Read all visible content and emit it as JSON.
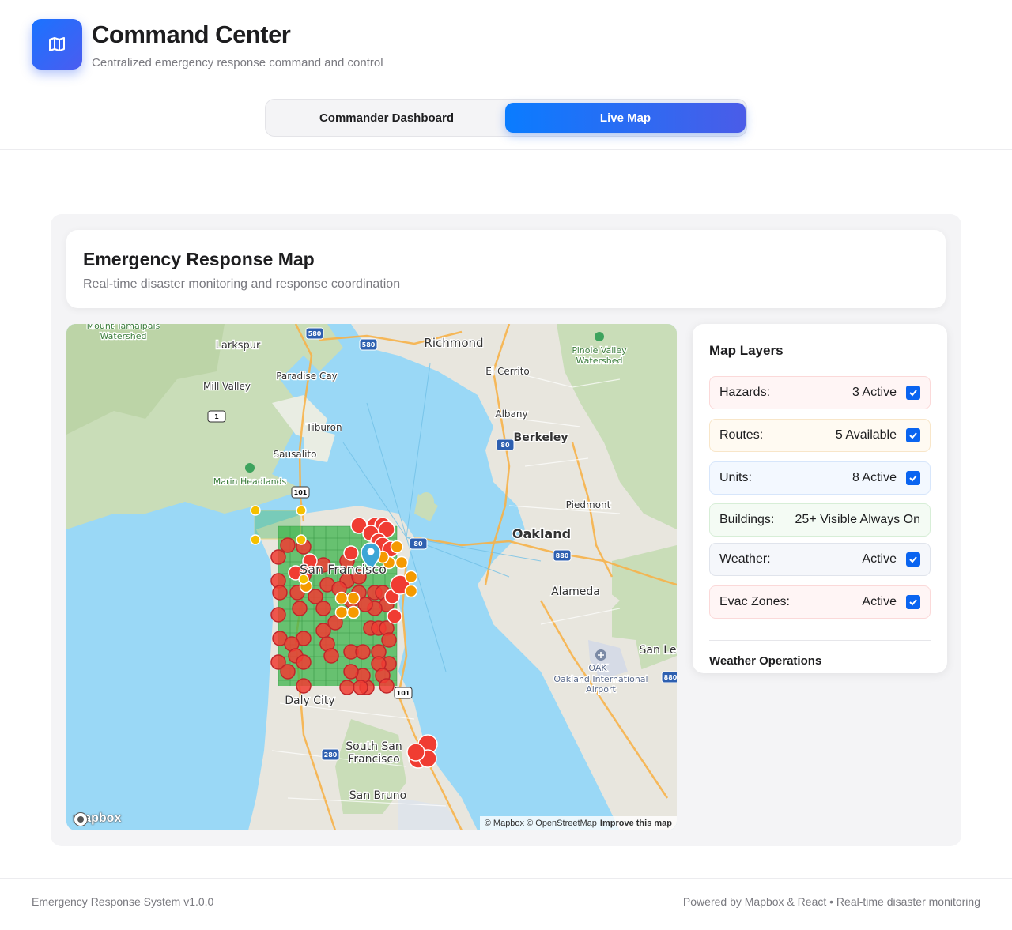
{
  "header": {
    "title": "Command Center",
    "subtitle": "Centralized emergency response command and control",
    "logo_icon": "map-icon"
  },
  "tabs": [
    {
      "label": "Commander Dashboard",
      "active": false
    },
    {
      "label": "Live Map",
      "active": true
    }
  ],
  "map_section": {
    "title": "Emergency Response Map",
    "description": "Real-time disaster monitoring and response coordination"
  },
  "map": {
    "place_labels": [
      "Mount Tamalpais Watershed",
      "Larkspur",
      "Richmond",
      "Paradise Cay",
      "Mill Valley",
      "El Cerrito",
      "Pinole Valley Watershed",
      "Albany",
      "Tiburon",
      "Berkeley",
      "Sausalito",
      "Marin Headlands",
      "Piedmont",
      "Oakland",
      "San Francisco",
      "Alameda",
      "San Le",
      "OAK",
      "Oakland International Airport",
      "Daly City",
      "South San Francisco",
      "San Bruno"
    ],
    "road_shields": [
      "580",
      "580",
      "1",
      "101",
      "80",
      "80",
      "880",
      "101",
      "280",
      "880"
    ],
    "attribution": "© Mapbox © OpenStreetMap",
    "improve_link": "Improve this map",
    "brand": "mapbox"
  },
  "layers_panel": {
    "title": "Map Layers",
    "items": [
      {
        "name": "Hazards:",
        "value": "3 Active",
        "checked": true,
        "bg": "#fff5f5",
        "border": "#fbd9d9"
      },
      {
        "name": "Routes:",
        "value": "5 Available",
        "checked": true,
        "bg": "#fffaf2",
        "border": "#f8e6c9"
      },
      {
        "name": "Units:",
        "value": "8 Active",
        "checked": true,
        "bg": "#f3f8ff",
        "border": "#d7e6fb"
      },
      {
        "name": "Buildings:",
        "value": "25+ Visible Always On",
        "checked": null,
        "bg": "#f4fbf4",
        "border": "#d7eed7"
      },
      {
        "name": "Weather:",
        "value": "Active",
        "checked": true,
        "bg": "#f5f7fb",
        "border": "#e0e4ec"
      },
      {
        "name": "Evac Zones:",
        "value": "Active",
        "checked": true,
        "bg": "#fff5f5",
        "border": "#fbd9d9"
      }
    ],
    "section_title": "Weather Operations"
  },
  "footer": {
    "left": "Emergency Response System v1.0.0",
    "right": "Powered by Mapbox & React • Real-time disaster monitoring"
  },
  "colors": {
    "accent": "#0a7cff",
    "hazard": "#f03c32",
    "warning": "#f5a000",
    "zone": "#3cb44b",
    "water": "#9ad8f6"
  }
}
